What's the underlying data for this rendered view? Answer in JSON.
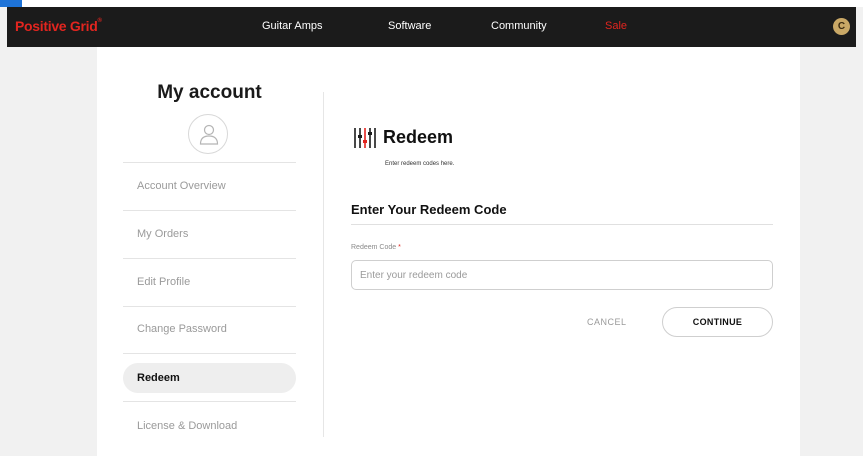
{
  "navbar": {
    "logo": "Positive Grid",
    "logo_mark": "®",
    "items": [
      {
        "label": "Guitar Amps"
      },
      {
        "label": "Software"
      },
      {
        "label": "Community"
      },
      {
        "label": "Sale"
      }
    ],
    "user_initial": "C"
  },
  "sidebar": {
    "title": "My account",
    "items": [
      {
        "label": "Account Overview"
      },
      {
        "label": "My Orders"
      },
      {
        "label": "Edit Profile"
      },
      {
        "label": "Change Password"
      },
      {
        "label": "Redeem"
      },
      {
        "label": "License & Download"
      }
    ],
    "active": "Redeem"
  },
  "content": {
    "title": "Redeem",
    "subtitle": "Enter redeem codes here.",
    "section_title": "Enter Your Redeem Code",
    "field_label": "Redeem Code",
    "required_mark": "*",
    "input_placeholder": "Enter your redeem code",
    "input_value": "",
    "cancel_label": "CANCEL",
    "continue_label": "CONTINUE"
  },
  "colors": {
    "brand_red": "#e2251f",
    "navbar_bg": "#1b1b1b",
    "avatar_gold": "#c9a866",
    "accent_blue": "#1e73d8"
  }
}
